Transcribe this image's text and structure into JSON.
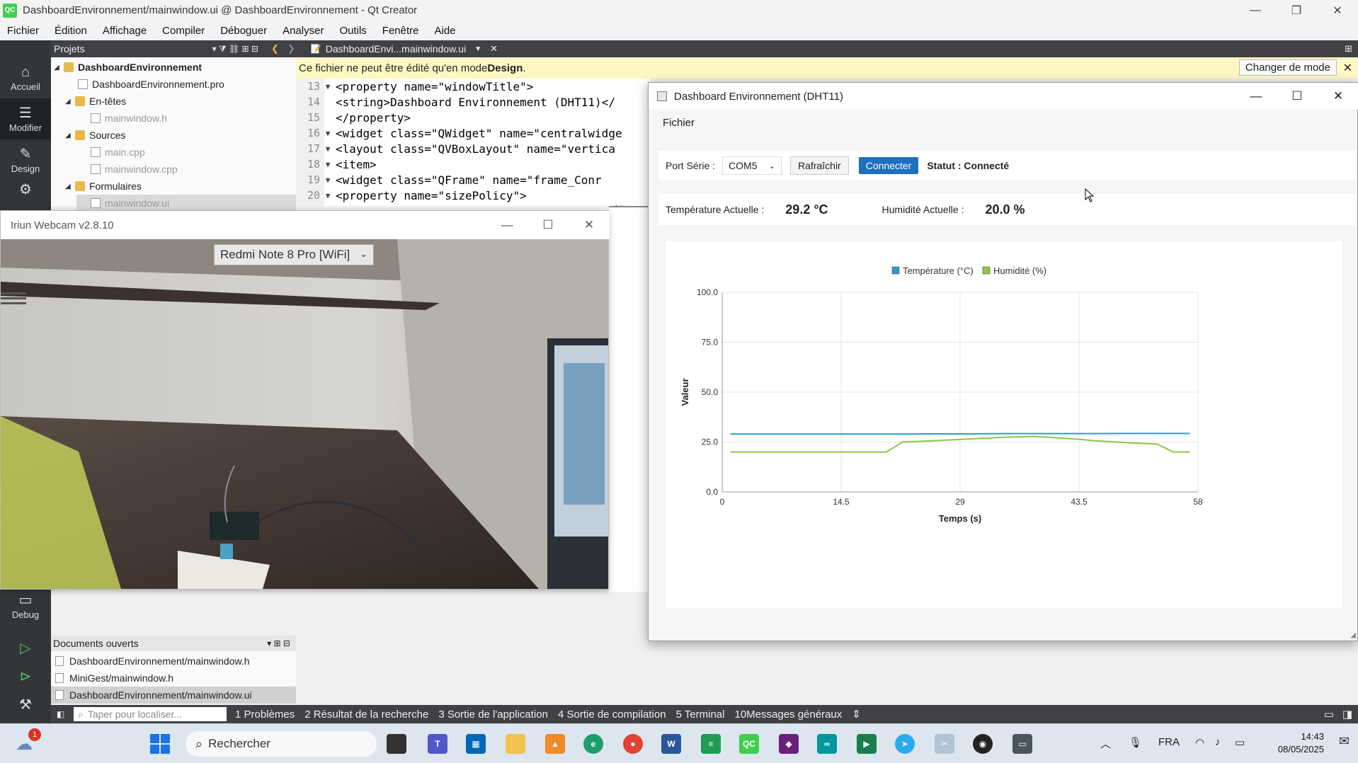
{
  "qt": {
    "title": "DashboardEnvironnement/mainwindow.ui @ DashboardEnvironnement - Qt Creator",
    "logo": "QC",
    "menu": [
      "Fichier",
      "Édition",
      "Affichage",
      "Compiler",
      "Déboguer",
      "Analyser",
      "Outils",
      "Fenêtre",
      "Aide"
    ],
    "projects_label": "Projets",
    "tab_label": "DashboardEnvi...mainwindow.ui",
    "modes": [
      "Accueil",
      "Modifier",
      "Design",
      "Debug"
    ],
    "tree": [
      {
        "label": "DashboardEnvironnement",
        "bold": true
      },
      {
        "label": "DashboardEnvironnement.pro"
      },
      {
        "label": "En-têtes"
      },
      {
        "label": "mainwindow.h"
      },
      {
        "label": "Sources"
      },
      {
        "label": "main.cpp"
      },
      {
        "label": "mainwindow.cpp"
      },
      {
        "label": "Formulaires"
      },
      {
        "label": "mainwindow.ui"
      }
    ],
    "infobar": {
      "text": "Ce fichier ne peut être édité qu'en mode ",
      "bold": "Design",
      "button": "Changer de mode"
    },
    "code": [
      {
        "ln": "13",
        "text": "  <property name=\"windowTitle\">"
      },
      {
        "ln": "14",
        "text": "   <string>Dashboard Environnement (DHT11)</"
      },
      {
        "ln": "15",
        "text": "  </property>"
      },
      {
        "ln": "16",
        "text": "  <widget class=\"QWidget\" name=\"centralwidge"
      },
      {
        "ln": "17",
        "text": "   <layout class=\"QVBoxLayout\" name=\"vertica"
      },
      {
        "ln": "18",
        "text": "    <item>"
      },
      {
        "ln": "19",
        "text": "     <widget class=\"QFrame\" name=\"frame_Conr"
      },
      {
        "ln": "20",
        "text": "      <property name=\"sizePolicy\">"
      }
    ],
    "code_trailing": "d\" vs",
    "open_docs_label": "Documents ouverts",
    "open_docs": [
      "DashboardEnvironnement/mainwindow.h",
      "MiniGest/mainwindow.h",
      "DashboardEnvironnement/mainwindow.ui"
    ],
    "locate_placeholder": "Taper pour localiser...",
    "output_tabs": [
      "1 Problèmes",
      "2 Résultat de la recherche",
      "3 Sortie de l'application",
      "4 Sortie de compilation",
      "5 Terminal",
      "10Messages généraux"
    ]
  },
  "webcam": {
    "title": "Iriun Webcam v2.8.10",
    "device": "Redmi Note 8 Pro [WiFi]"
  },
  "dashboard": {
    "title": "Dashboard Environnement (DHT11)",
    "menu": "Fichier",
    "port_label": "Port Série :",
    "port_value": "COM5",
    "refresh_button": "Rafraîchir",
    "connect_button": "Connecter",
    "status": "Statut : Connecté",
    "temp_label": "Température Actuelle :",
    "temp_value": "29.2 °C",
    "hum_label": "Humidité Actuelle :",
    "hum_value": "20.0 %"
  },
  "chart_data": {
    "type": "line",
    "xlabel": "Temps (s)",
    "ylabel": "Valeur",
    "xlim": [
      0,
      58
    ],
    "ylim": [
      0,
      100
    ],
    "x_ticks": [
      "0",
      "14.5",
      "29",
      "43.5",
      "58"
    ],
    "y_ticks": [
      "0.0",
      "25.0",
      "50.0",
      "75.0",
      "100.0"
    ],
    "grid": true,
    "legend": "top-center",
    "series": [
      {
        "name": "Température (°C)",
        "color": "#2a9dc9",
        "x": [
          1,
          5,
          10,
          15,
          20,
          22,
          25,
          30,
          35,
          40,
          45,
          50,
          55,
          57
        ],
        "y": [
          29.0,
          29.0,
          29.0,
          29.0,
          29.0,
          29.0,
          29.1,
          29.1,
          29.2,
          29.2,
          29.2,
          29.3,
          29.3,
          29.3
        ]
      },
      {
        "name": "Humidité (%)",
        "color": "#8dc63f",
        "x": [
          1,
          10,
          20,
          21,
          22,
          25,
          30,
          35,
          38,
          42,
          46,
          50,
          53,
          55,
          57
        ],
        "y": [
          20.0,
          20.0,
          20.0,
          22.5,
          25.0,
          25.5,
          26.5,
          27.5,
          27.8,
          26.8,
          25.5,
          24.5,
          24.0,
          20.0,
          20.0
        ]
      }
    ]
  },
  "taskbar": {
    "search": "Rechercher",
    "notif_badge": "1",
    "lang": "FRA",
    "time": "14:43",
    "date": "08/05/2025"
  },
  "colors": {
    "connect_button": "#1e6fbf",
    "qt_dark": "#32363b",
    "infobar": "#fff8c4"
  }
}
